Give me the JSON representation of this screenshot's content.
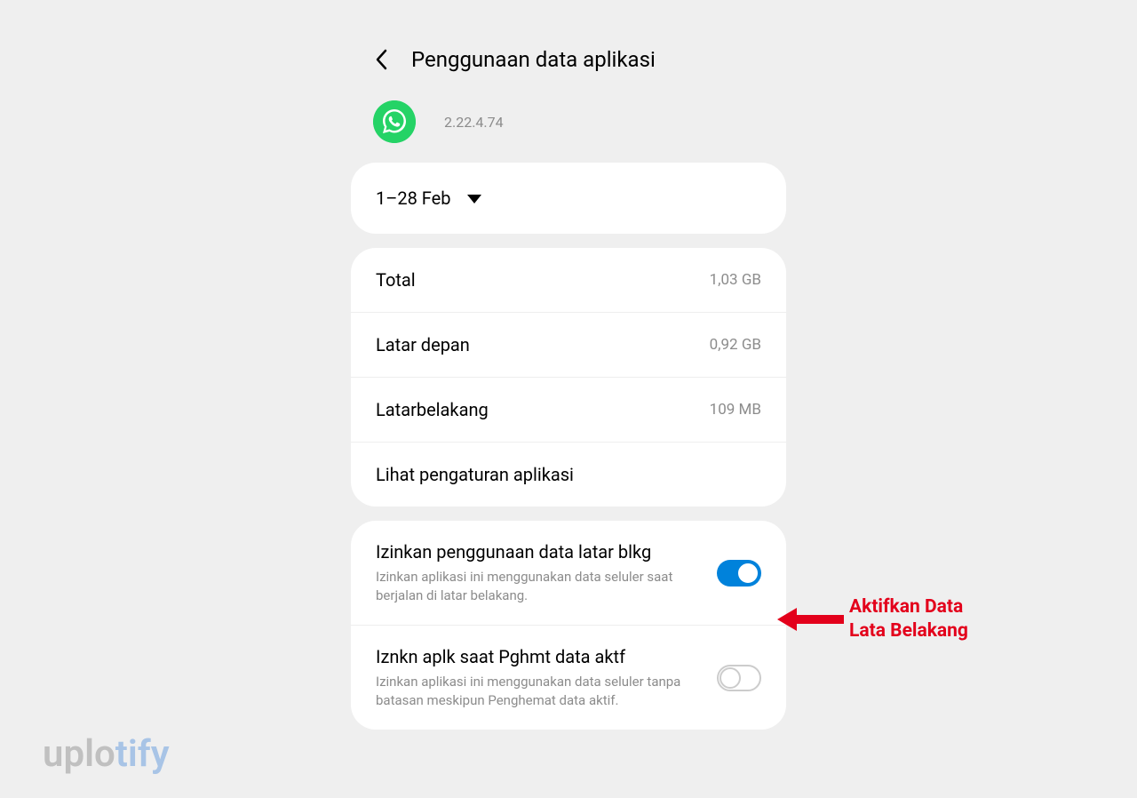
{
  "header": {
    "title": "Penggunaan data aplikasi"
  },
  "app": {
    "version": "2.22.4.74"
  },
  "dateRange": {
    "text": "1–28 Feb"
  },
  "stats": {
    "total": {
      "label": "Total",
      "value": "1,03 GB"
    },
    "foreground": {
      "label": "Latar depan",
      "value": "0,92 GB"
    },
    "background": {
      "label": "Latarbelakang",
      "value": "109 MB"
    },
    "settingsLink": "Lihat pengaturan aplikasi"
  },
  "toggles": {
    "backgroundData": {
      "title": "Izinkan penggunaan data latar blkg",
      "desc": "Izinkan aplikasi ini menggunakan data seluler saat berjalan di latar belakang."
    },
    "dataSaver": {
      "title": "Iznkn aplk saat Pghmt data aktf",
      "desc": "Izinkan aplikasi ini menggunakan data seluler tanpa batasan meskipun Penghemat data aktif."
    }
  },
  "annotation": {
    "line1": "Aktifkan Data",
    "line2": "Lata Belakang"
  },
  "watermark": {
    "part1": "uplo",
    "part2": "tify"
  }
}
